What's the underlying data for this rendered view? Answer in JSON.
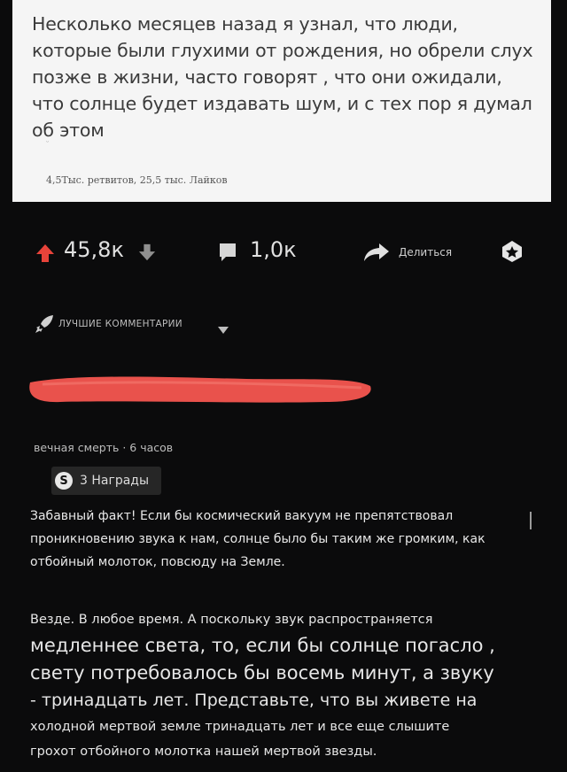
{
  "tweet": {
    "text": "Несколько месяцев назад я узнал, что люди, которые были глухими от рождения, но обрели слух позже в жизни, часто говорят , что они ожидали, что солнце будет издавать шум, и с тех пор я думал об этом",
    "stats": "4,5Тыс. ретвитов, 25,5 тыс. Лайков"
  },
  "actions": {
    "score": "45,8к",
    "comments": "1,0к",
    "share_label": "Делиться"
  },
  "sort": {
    "label": "ЛУЧШИЕ КОММЕНТАРИИ"
  },
  "comment": {
    "meta": "вечная смерть · 6 часов",
    "awards_label": "3 Награды",
    "paragraph1": "Забавный факт! Если бы космический вакуум не препятствовал проникновению звука к нам, солнце было бы таким же громким, как отбойный молоток, повсюду на Земле.",
    "paragraph2_line1": "Везде. В любое время. А поскольку звук распространяется",
    "paragraph2_line2": "медленнее света, то, если бы солнце погасло ,",
    "paragraph2_line3": "свету потребовалось бы восемь минут, а звуку",
    "paragraph2_line4": "- тринадцать лет. Представьте, что вы живете на",
    "paragraph2_line5": "холодной мертвой земле тринадцать лет и все еще слышите",
    "paragraph2_line6": "грохот отбойного молотка нашей мертвой звезды."
  },
  "colors": {
    "upvote": "#e8433a",
    "redaction": "#e9524c",
    "background": "#0b0b0c",
    "card": "#f5f5f5"
  }
}
